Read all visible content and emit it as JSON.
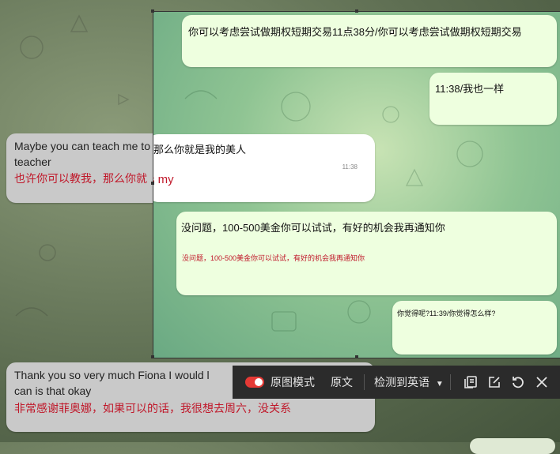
{
  "chat": {
    "msg1_en": "Maybe you can teach me to",
    "msg1_en2": "teacher",
    "msg1_cn": "也许你可以教我，那么你就",
    "msg2_en": "Thank you so very much Fiona I would l",
    "msg2_en2": "can is that okay",
    "msg2_cn": "非常感谢菲奥娜，如果可以的话，我很想去周六，没关系"
  },
  "overlay": {
    "b1_text": "你可以考虑尝试做期权短期交易11点38分/你可以考虑尝试做期权短期交易",
    "b2_text": "11:38/我也一样",
    "b3_text": "那么你就是我的美人",
    "b3_time": "11:38",
    "b3_red": "s my",
    "b4_text": "没问题，100-500美金你可以试试，有好的机会我再通知你",
    "b4_red": "没问题，100-500美金你可以试试，有好的机会我再通知你",
    "b5_text": "你觉得呢?11:39/你觉得怎么样?"
  },
  "toolbar": {
    "mode_label": "原图模式",
    "original_label": "原文",
    "detect_label": "检测到英语",
    "icons": [
      "copy-icon",
      "edit-icon",
      "refresh-icon",
      "close-icon"
    ],
    "toggle_color": "#e53935"
  }
}
